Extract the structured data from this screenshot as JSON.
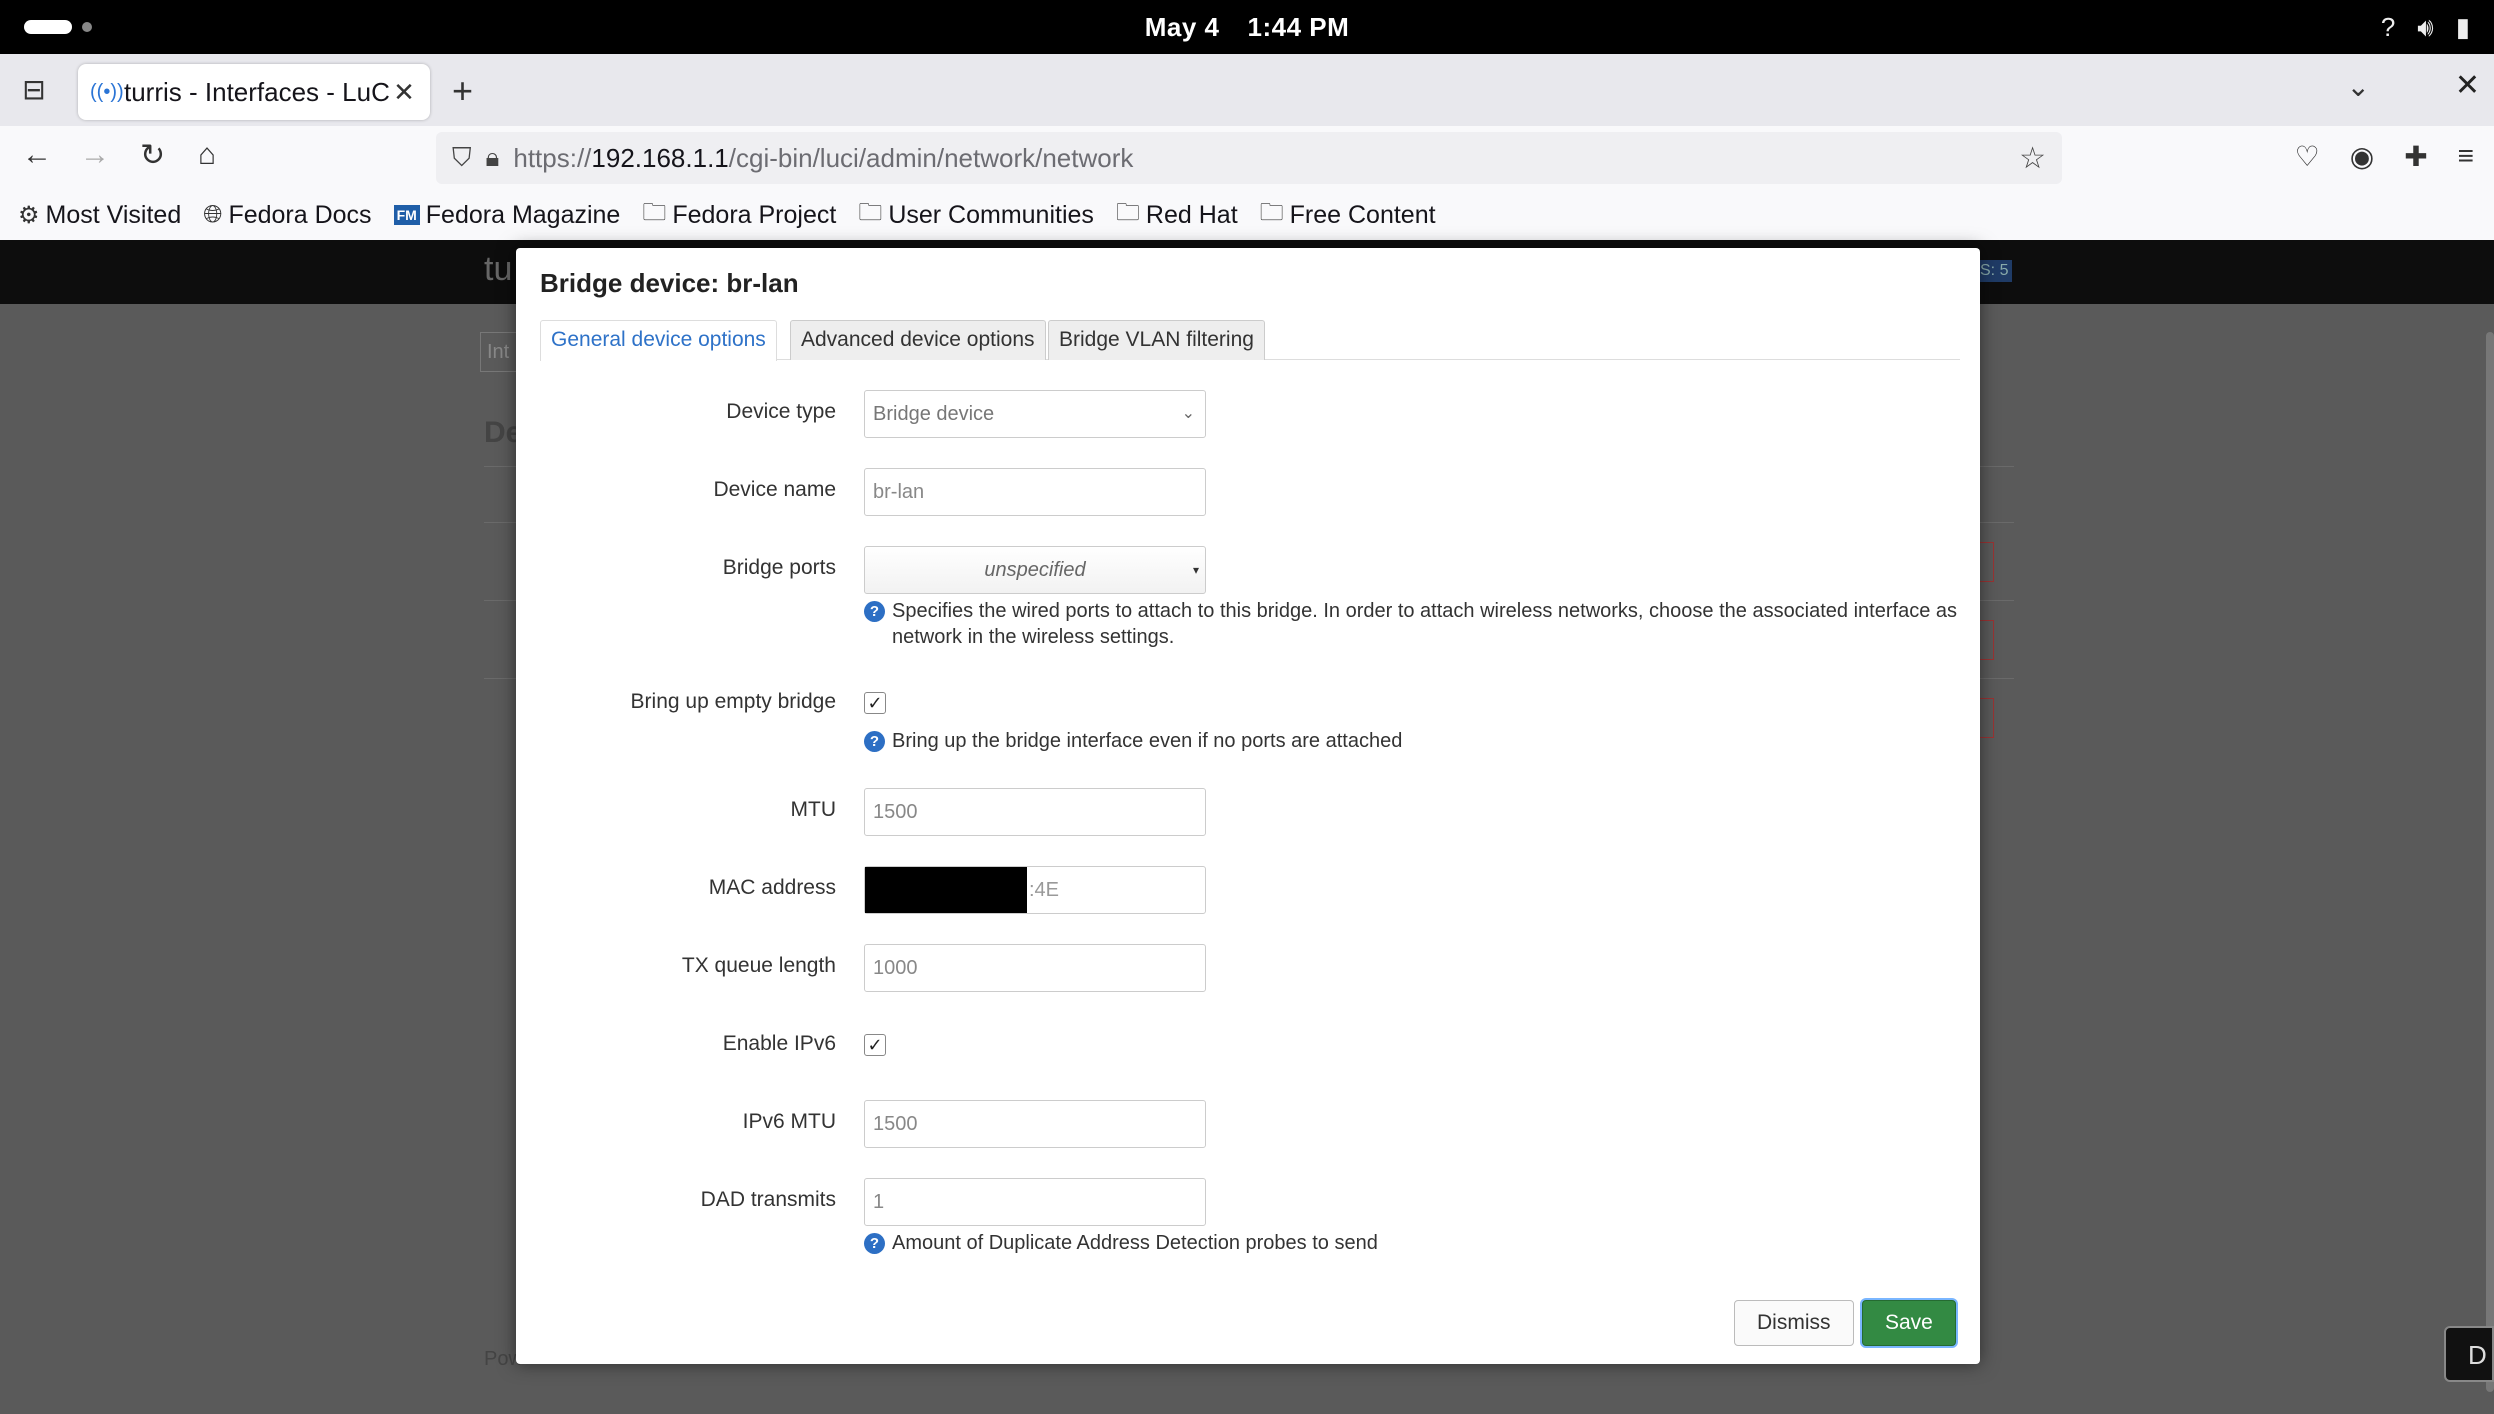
{
  "system_bar": {
    "date": "May 4",
    "time": "1:44 PM"
  },
  "browser": {
    "tab_title": "turris - Interfaces - LuCI",
    "url_prefix": "https://",
    "url_host": "192.168.1.1",
    "url_path": "/cgi-bin/luci/admin/network/network",
    "bookmarks": [
      {
        "label": "Most Visited",
        "icon": "gear-icon"
      },
      {
        "label": "Fedora Docs",
        "icon": "globe-icon"
      },
      {
        "label": "Fedora Magazine",
        "icon": "fedora-magazine-icon"
      },
      {
        "label": "Fedora Project",
        "icon": "folder-icon"
      },
      {
        "label": "User Communities",
        "icon": "folder-icon"
      },
      {
        "label": "Red Hat",
        "icon": "folder-icon"
      },
      {
        "label": "Free Content",
        "icon": "folder-icon"
      }
    ]
  },
  "background_page": {
    "brand": "tu",
    "tab": "Int",
    "heading": "De",
    "col": "D",
    "footer": "Pow",
    "side_button": "D"
  },
  "modal": {
    "title": "Bridge device: br-lan",
    "tabs": [
      "General device options",
      "Advanced device options",
      "Bridge VLAN filtering"
    ],
    "fields": {
      "device_type": {
        "label": "Device type",
        "value": "Bridge device"
      },
      "device_name": {
        "label": "Device name",
        "value": "br-lan"
      },
      "bridge_ports": {
        "label": "Bridge ports",
        "value": "unspecified",
        "help": "Specifies the wired ports to attach to this bridge. In order to attach wireless networks, choose the associated interface as network in the wireless settings."
      },
      "bring_up_empty": {
        "label": "Bring up empty bridge",
        "checked": true,
        "help": "Bring up the bridge interface even if no ports are attached"
      },
      "mtu": {
        "label": "MTU",
        "placeholder": "1500"
      },
      "mac": {
        "label": "MAC address",
        "suffix": ":4E"
      },
      "txqueuelen": {
        "label": "TX queue length",
        "placeholder": "1000"
      },
      "ipv6": {
        "label": "Enable IPv6",
        "checked": true
      },
      "ipv6_mtu": {
        "label": "IPv6 MTU",
        "placeholder": "1500"
      },
      "dad": {
        "label": "DAD transmits",
        "placeholder": "1",
        "help": "Amount of Duplicate Address Detection probes to send"
      }
    },
    "buttons": {
      "dismiss": "Dismiss",
      "save": "Save"
    }
  }
}
